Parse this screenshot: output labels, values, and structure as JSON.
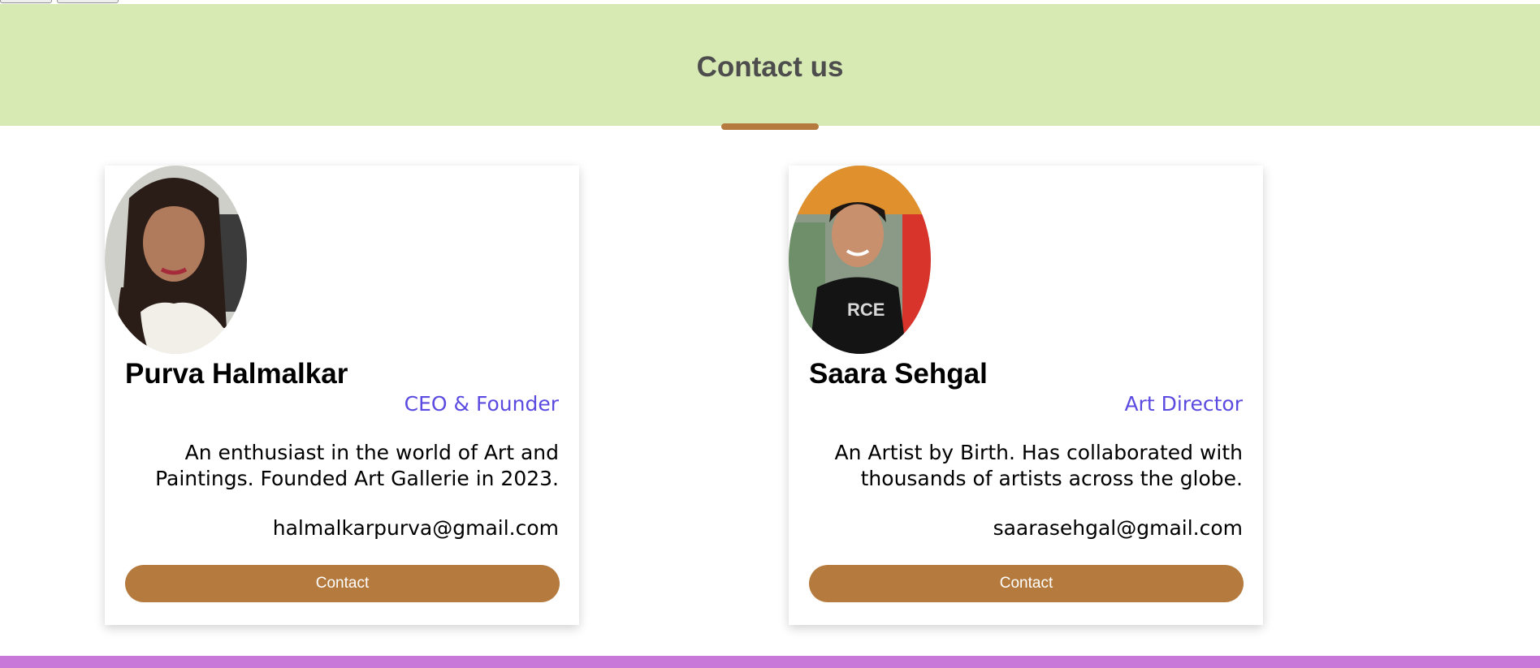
{
  "colors": {
    "accent": "#b57a3e",
    "role": "#5b4be0",
    "header_bg": "#d7eab3",
    "footer": "#c878d8"
  },
  "header": {
    "title": "Contact us"
  },
  "contacts": [
    {
      "name": "Purva Halmalkar",
      "role": "CEO & Founder",
      "bio": "An enthusiast in the world of Art and Paintings. Founded Art Gallerie in 2023.",
      "email": "halmalkarpurva@gmail.com",
      "button_label": "Contact"
    },
    {
      "name": "Saara Sehgal",
      "role": "Art Director",
      "bio": "An Artist by Birth. Has collaborated with thousands of artists across the globe.",
      "email": "saarasehgal@gmail.com",
      "button_label": "Contact"
    }
  ]
}
